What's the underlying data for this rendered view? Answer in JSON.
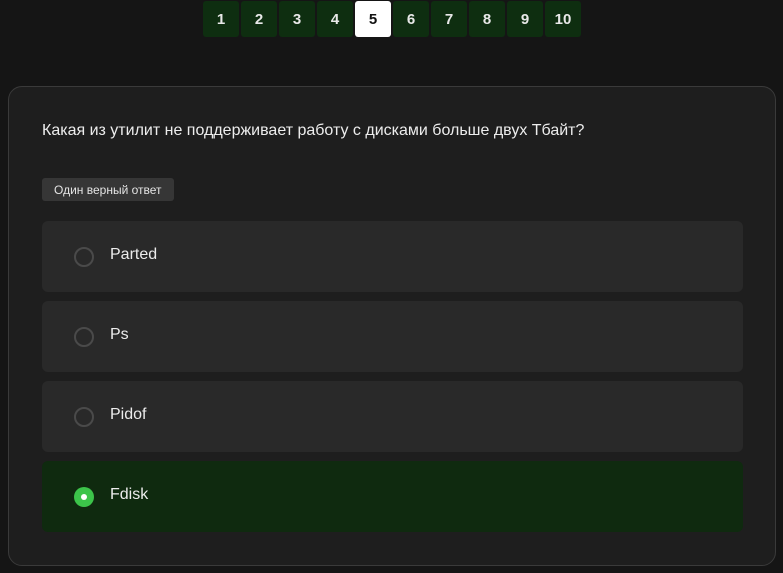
{
  "pagination": {
    "current": "5",
    "pages": [
      "1",
      "2",
      "3",
      "4",
      "5",
      "6",
      "7",
      "8",
      "9",
      "10"
    ]
  },
  "question": {
    "text": "Какая из утилит не поддерживает работу с дисками больше двух Тбайт?",
    "answer_type": "Один верный ответ"
  },
  "options": [
    {
      "label": "Parted",
      "selected": false
    },
    {
      "label": "Ps",
      "selected": false
    },
    {
      "label": "Pidof",
      "selected": false
    },
    {
      "label": "Fdisk",
      "selected": true
    }
  ],
  "colors": {
    "page_bg": "#151515",
    "card_bg": "#1e1e1e",
    "option_bg": "#292929",
    "selected_option_bg": "#0f2a0f",
    "accent_green": "#3cc44a",
    "page_button_bg": "#0e2e10"
  }
}
